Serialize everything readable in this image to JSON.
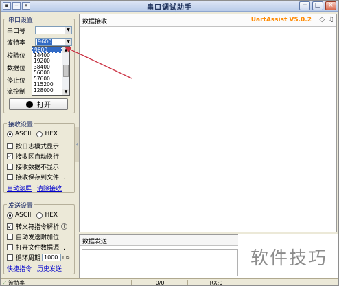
{
  "window": {
    "title": "串口调试助手",
    "left_buttons": [
      "▪",
      "−",
      "▾"
    ],
    "right_buttons": [
      "−",
      "□",
      "×"
    ]
  },
  "serial_settings": {
    "group_label": "串口设置",
    "port_label": "串口号",
    "port_value": "",
    "baud_label": "波特率",
    "baud_value": "9600",
    "parity_label": "校验位",
    "databits_label": "数据位",
    "stopbits_label": "停止位",
    "flow_label": "流控制",
    "baud_options": [
      "9600",
      "14400",
      "19200",
      "38400",
      "56000",
      "57600",
      "115200",
      "128000"
    ],
    "open_button": "打开"
  },
  "receive_settings": {
    "group_label": "接收设置",
    "radio_ascii": "ASCII",
    "radio_hex": "HEX",
    "checkboxes": [
      {
        "label": "按日志模式显示",
        "checked": false
      },
      {
        "label": "接收区自动换行",
        "checked": true
      },
      {
        "label": "接收数据不显示",
        "checked": false
      },
      {
        "label": "接收保存到文件…",
        "checked": false
      }
    ],
    "link_autoclear": "自动滚屏",
    "link_clear": "清除接收"
  },
  "send_settings": {
    "group_label": "发送设置",
    "radio_ascii": "ASCII",
    "radio_hex": "HEX",
    "checkboxes": [
      {
        "label": "转义符指令解析",
        "checked": true
      },
      {
        "label": "自动发送附加位",
        "checked": false
      },
      {
        "label": "打开文件数据源…",
        "checked": false
      },
      {
        "label": "循环周期",
        "checked": false
      }
    ],
    "cycle_value": "1000",
    "cycle_unit": "ms",
    "link_shortcut": "快捷指令",
    "link_history": "历史发送"
  },
  "receive_panel": {
    "title": "数据接收",
    "brand": "UartAssist V5.0.2"
  },
  "send_panel": {
    "title": "数据发送"
  },
  "watermark": "软件技巧",
  "statusbar": {
    "left": "波特率",
    "count": "0/0",
    "rx": "RX:0"
  },
  "colors": {
    "accent": "#316ac5",
    "brand": "#ff8a00",
    "link": "#0000cc",
    "annotation_arrow": "#cc3344"
  }
}
